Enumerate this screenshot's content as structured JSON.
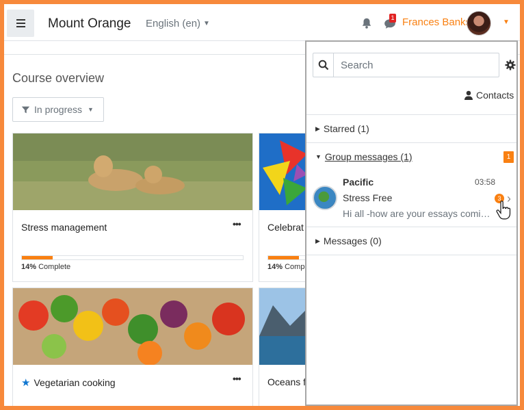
{
  "navbar": {
    "site_name": "Mount Orange",
    "language": "English (en)",
    "chat_badge": "1",
    "user_name": "Frances Banks"
  },
  "main": {
    "title": "Course overview",
    "filter_label": "In progress",
    "courses": [
      {
        "title": "Stress management",
        "progress_label": "14%",
        "progress_suffix": "Complete",
        "progress": 0.14
      },
      {
        "title": "Celebrat",
        "progress_label": "14%",
        "progress_suffix": "Comp",
        "progress": 0.14
      },
      {
        "title": "Vegetarian cooking",
        "starred": true
      },
      {
        "title": "Oceans f"
      }
    ]
  },
  "drawer": {
    "search_placeholder": "Search",
    "contacts_label": "Contacts",
    "sections": {
      "starred": "Starred (1)",
      "group": "Group messages (1)",
      "group_badge": "1",
      "messages": "Messages (0)"
    },
    "conversation": {
      "name": "Pacific",
      "time": "03:58",
      "subject": "Stress Free",
      "preview": "Hi all -how are your essays comin...",
      "unread": "3"
    }
  },
  "colors": {
    "accent": "#f98012",
    "frame": "#f7893b",
    "star": "#1177d1",
    "badge_red": "#e12222"
  }
}
